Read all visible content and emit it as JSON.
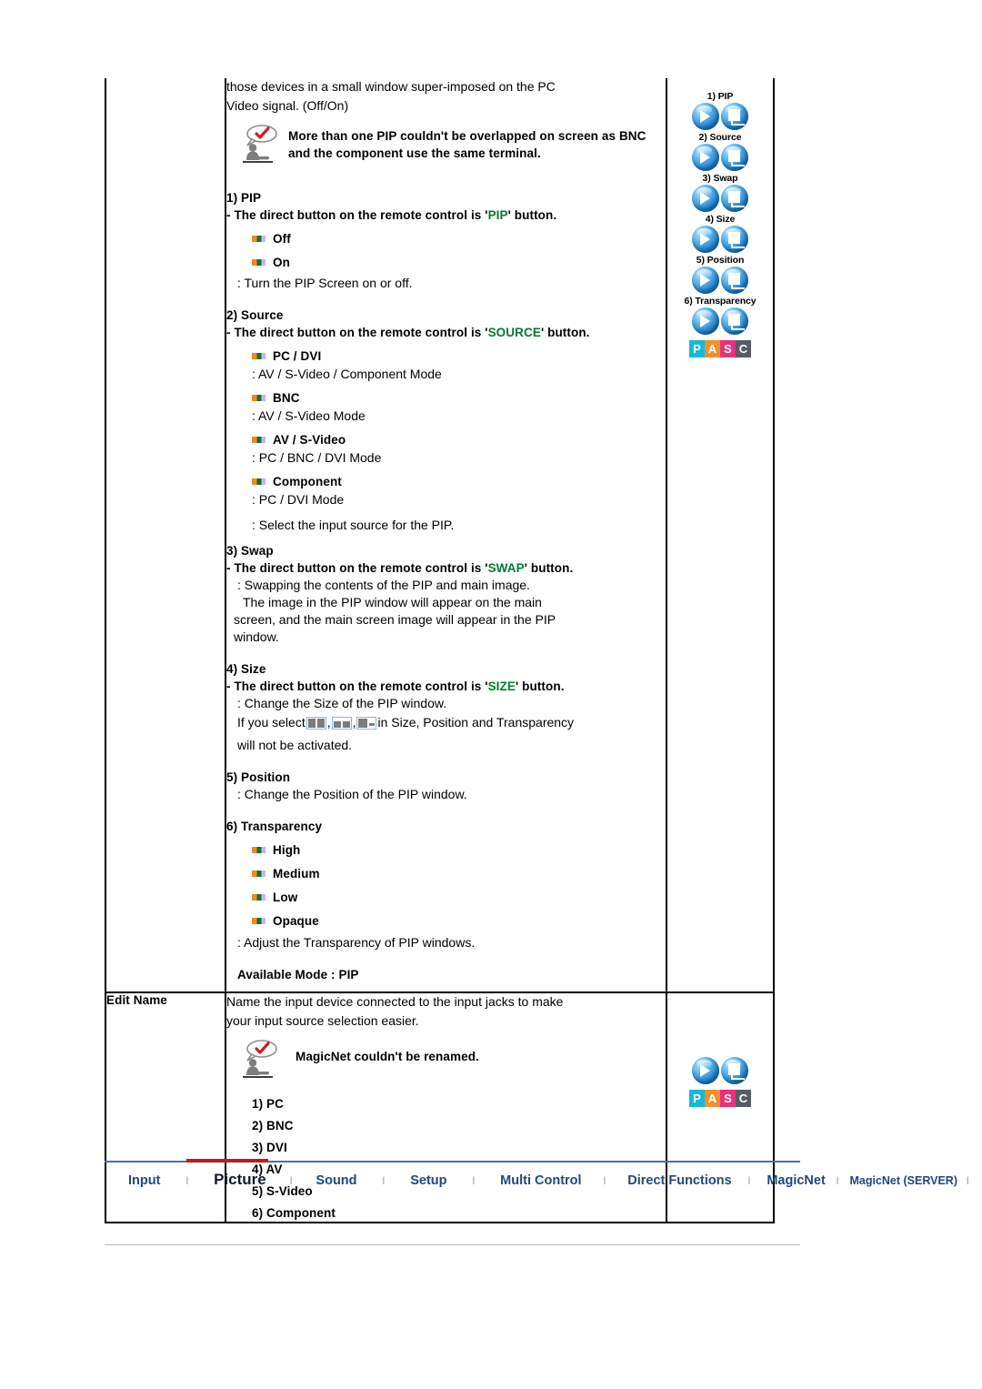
{
  "document": {
    "intro_lines": [
      "those devices in a small window super-imposed on the PC",
      "Video signal. (Off/On)"
    ],
    "notice_pip": "More than one PIP couldn't be overlapped on screen as BNC and the component use the same terminal.",
    "sections": [
      {
        "heading": "1) PIP",
        "subline_pre": "- The direct button on the remote control is '",
        "subline_key": "PIP",
        "subline_post": "' button.",
        "options": [
          {
            "label": "Off",
            "desc": ""
          },
          {
            "label": "On",
            "desc": ""
          }
        ],
        "desc": ": Turn the PIP Screen on or off."
      },
      {
        "heading": "2) Source",
        "subline_pre": "- The direct button on the remote control is '",
        "subline_key": "SOURCE",
        "subline_post": "' button.",
        "options": [
          {
            "label": "PC / DVI",
            "desc": ": AV / S-Video / Component Mode"
          },
          {
            "label": "BNC",
            "desc": ": AV / S-Video Mode"
          },
          {
            "label": "AV / S-Video",
            "desc": ": PC / BNC / DVI Mode"
          },
          {
            "label": "Component",
            "desc": ": PC / DVI Mode"
          }
        ],
        "desc": ": Select the input source for the PIP."
      },
      {
        "heading": "3) Swap",
        "subline_pre": "- The direct button on the remote control is '",
        "subline_key": "SWAP",
        "subline_post": "' button.",
        "body_lines": [
          ": Swapping the contents of the PIP and main image.",
          "The image in the PIP window will appear on the main",
          "screen, and the main screen image will appear in the PIP",
          "window."
        ]
      },
      {
        "heading": "4) Size",
        "subline_pre": "- The direct button on the remote control is '",
        "subline_key": "SIZE",
        "subline_post": "' button.",
        "body_lines": [
          ": Change the Size of the PIP window."
        ],
        "inline_pre": "If you select ",
        "inline_mid": ", ",
        "inline_post": " in Size, Position and Transparency",
        "inline_tail": "will not be activated."
      },
      {
        "heading": "5) Position",
        "body_lines": [
          ": Change the Position of the PIP window."
        ]
      },
      {
        "heading": "6) Transparency",
        "options": [
          {
            "label": "High",
            "desc": ""
          },
          {
            "label": "Medium",
            "desc": ""
          },
          {
            "label": "Low",
            "desc": ""
          },
          {
            "label": "Opaque",
            "desc": ""
          }
        ],
        "desc": ": Adjust the Transparency of PIP windows."
      }
    ],
    "available_mode": "Available Mode : PIP",
    "edit_name": {
      "label": "Edit Name",
      "intro_lines": [
        "Name the input device connected to the input jacks to make",
        "your input source selection easier."
      ],
      "notice": "MagicNet couldn't be renamed.",
      "items": [
        "1) PC",
        "2) BNC",
        "3) DVI",
        "4) AV",
        "5) S-Video",
        "6) Component"
      ]
    }
  },
  "side_icons": {
    "captions": [
      "1) PIP",
      "2) Source",
      "3) Swap",
      "4) Size",
      "5) Position",
      "6) Transparency"
    ],
    "badge": [
      "P",
      "A",
      "S",
      "C"
    ]
  },
  "bottom_nav": {
    "items": [
      {
        "label": "Input",
        "active": false,
        "small": false
      },
      {
        "label": "Picture",
        "active": true,
        "small": false
      },
      {
        "label": "Sound",
        "active": false,
        "small": false
      },
      {
        "label": "Setup",
        "active": false,
        "small": false
      },
      {
        "label": "Multi Control",
        "active": false,
        "small": false
      },
      {
        "label": "Direct Functions",
        "active": false,
        "small": false
      },
      {
        "label": "MagicNet",
        "active": false,
        "small": false
      },
      {
        "label": "MagicNet (SERVER)",
        "active": false,
        "small": true
      }
    ],
    "separator": "l"
  },
  "colors": {
    "key_green": "#007a2f",
    "nav_blue": "#20497e",
    "nav_rule": "#4a6ea8",
    "accent_red": "#b41f24",
    "badge_p": "#17b8d8",
    "badge_a": "#f0912d",
    "badge_s": "#e8317d",
    "badge_c": "#555c66"
  }
}
